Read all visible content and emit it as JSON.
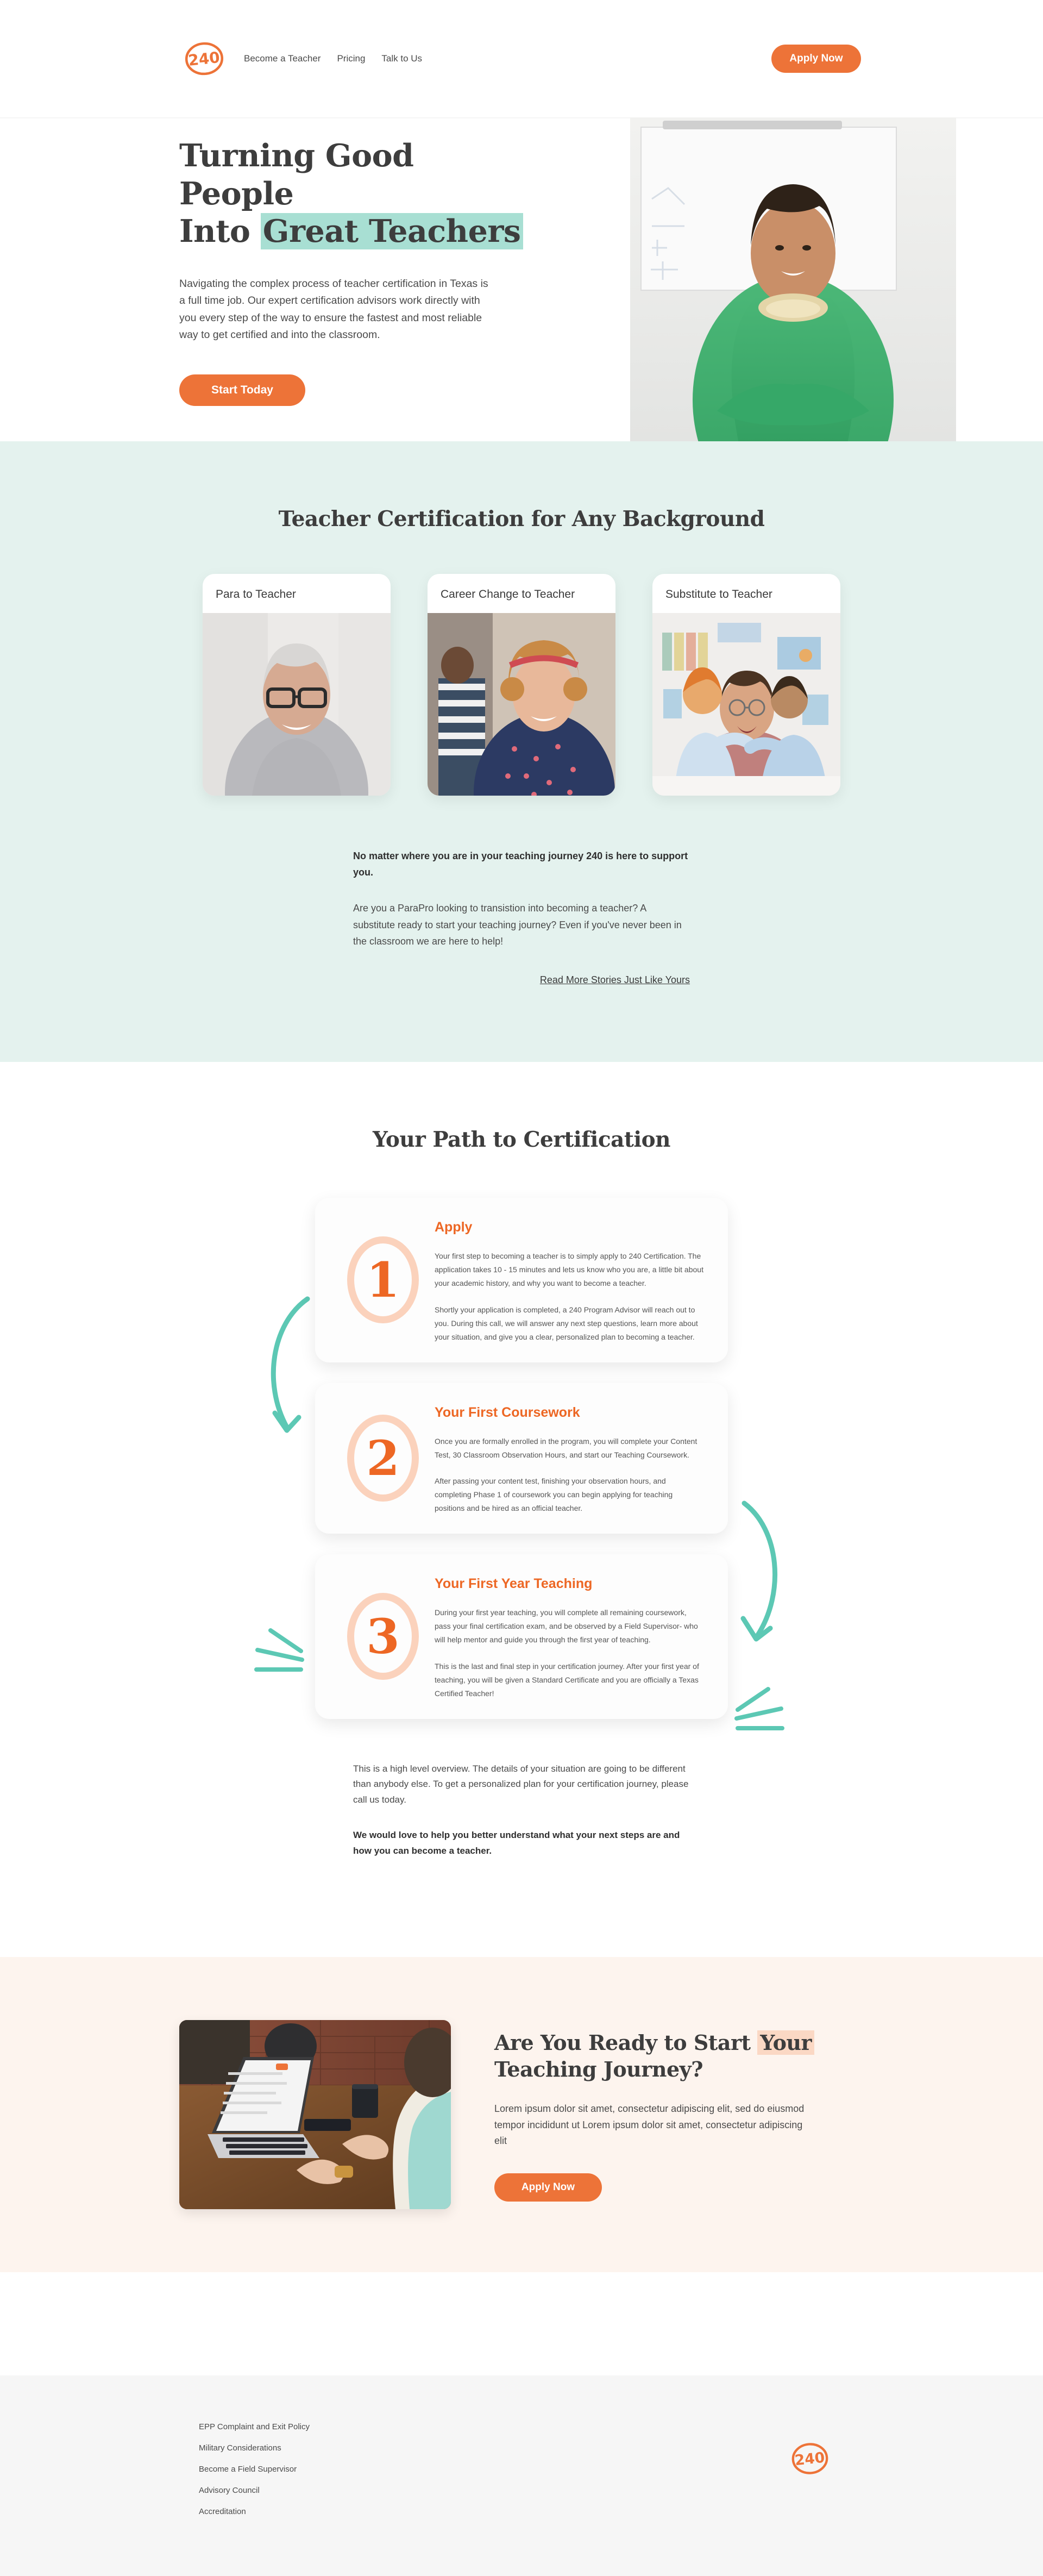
{
  "brand": {
    "logo_text": "240",
    "accent_orange": "#ED7338",
    "accent_orange_dark": "#ED6724",
    "teal_highlight": "#A8DFD3",
    "teal_band": "#E4F2EE",
    "peach_highlight": "#FBD8C4",
    "cta_band": "#FDF4EE",
    "footer_bg": "#F6F6F6"
  },
  "nav": {
    "links": [
      {
        "label": "Become a Teacher",
        "name": "nav-link-become-a-teacher"
      },
      {
        "label": "Pricing",
        "name": "nav-link-pricing"
      },
      {
        "label": "Talk to Us",
        "name": "nav-link-talk-to-us"
      }
    ],
    "cta_label": "Apply Now"
  },
  "hero": {
    "heading_line1": "Turning Good People",
    "heading_line2_plain": "Into ",
    "heading_line2_highlight": "Great Teachers",
    "paragraph": "Navigating the complex process of teacher certification in Texas is a full time job. Our expert certification advisors work directly with you every step of the way to ensure the fastest and most reliable way to get certified and into the classroom.",
    "cta_label": "Start Today",
    "image_alt": "smiling-teacher-in-green-cardigan-in-classroom"
  },
  "backgrounds": {
    "title": "Teacher Certification for Any Background",
    "cards": [
      {
        "title": "Para to Teacher",
        "image_alt": "smiling-woman-with-short-grey-hair-and-glasses"
      },
      {
        "title": "Career Change to Teacher",
        "image_alt": "smiling-woman-with-curly-hair-and-polka-dot-top"
      },
      {
        "title": "Substitute to Teacher",
        "image_alt": "teacher-hugged-by-three-students-in-art-classroom"
      }
    ],
    "lead": "No matter where you are in your teaching journey 240 is here to support you.",
    "body": "Are you a ParaPro looking to transistion into becoming a teacher? A substitute ready to start your teaching journey? Even if you've never been in the classroom we are here to help!",
    "read_more_label": "Read More Stories Just Like Yours"
  },
  "path": {
    "title": "Your Path to Certification",
    "steps": [
      {
        "number": "1",
        "title": "Apply",
        "paragraph1": "Your first step to becoming a teacher is to simply apply to 240 Certification. The application takes 10 - 15 minutes and lets us know who you are, a little bit about your academic history, and why you want to become a teacher.",
        "paragraph2": "Shortly your application is completed, a 240 Program Advisor will reach out to you. During this call, we will answer any next step questions, learn more about your situation, and give you a clear, personalized plan to becoming a teacher."
      },
      {
        "number": "2",
        "title": "Your First Coursework",
        "paragraph1": "Once you are formally enrolled in the program, you will complete your Content Test, 30 Classroom Observation Hours, and start our Teaching Coursework.",
        "paragraph2": "After passing your content test, finishing your observation hours, and completing Phase 1 of coursework you can begin applying for teaching positions and be hired as an official teacher."
      },
      {
        "number": "3",
        "title": "Your First Year Teaching",
        "paragraph1": "During your first year teaching, you will complete all remaining coursework, pass your final certification exam, and be observed by a Field Supervisor- who will help mentor and guide you through the first year of teaching.",
        "paragraph2": "This is the last and final step in your certification journey. After your first year of teaching, you will be given a Standard Certificate and you are officially a Texas Certified Teacher!"
      }
    ],
    "closing_paragraph": "This is a high level overview. The details of your situation are going to be different than anybody else. To get a personalized plan for your certification journey, please call us today.",
    "closing_strong": "We would love to help you better understand what your next steps are and how you can become a teacher."
  },
  "cta": {
    "heading_part1": "Are You Ready to Start ",
    "heading_highlight": "Your",
    "heading_part2": "Teaching Journey?",
    "paragraph": "Lorem ipsum dolor sit amet, consectetur adipiscing elit, sed do eiusmod tempor incididunt ut Lorem ipsum dolor sit amet, consectetur adipiscing elit",
    "button_label": "Apply Now",
    "image_alt": "woman-typing-on-laptop-at-wooden-desk-with-coffee"
  },
  "footer": {
    "links": [
      {
        "label": "EPP Complaint and Exit Policy"
      },
      {
        "label": "Military Considerations"
      },
      {
        "label": "Become a Field Supervisor"
      },
      {
        "label": "Advisory Council"
      },
      {
        "label": "Accreditation"
      }
    ],
    "logo_text": "240"
  }
}
